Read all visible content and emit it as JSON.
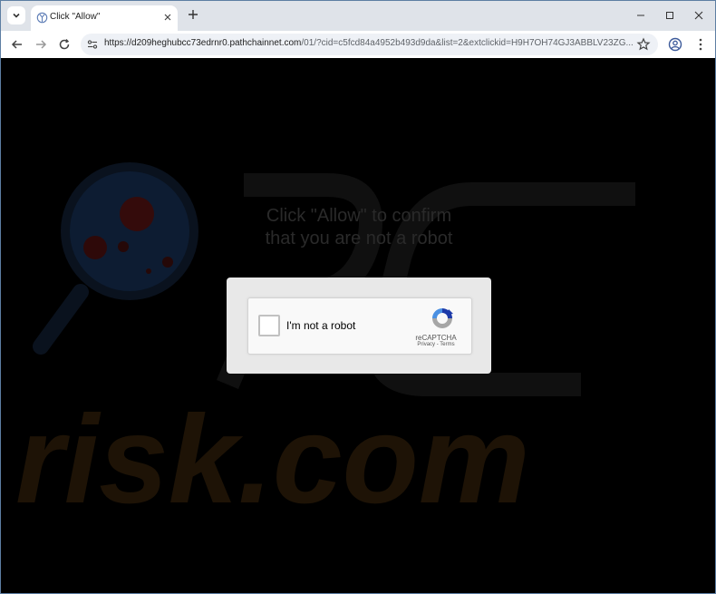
{
  "browser": {
    "tab": {
      "title": "Click \"Allow\""
    },
    "address_bar": {
      "url_host": "https://d209heghubcc73edrnr0.pathchainnet.com",
      "url_rest": "/01/?cid=c5fcd84a4952b493d9da&list=2&extclickid=H9H7OH74GJ3ABBLV23ZG..."
    }
  },
  "page": {
    "watermark_text": "risk.com",
    "message_line1": "Click \"Allow\" to confirm",
    "message_line2": "that you are not a robot"
  },
  "recaptcha": {
    "checkbox_label": "I'm not a robot",
    "brand": "reCAPTCHA",
    "privacy_link": "Privacy",
    "separator": " - ",
    "terms_link": "Terms"
  }
}
